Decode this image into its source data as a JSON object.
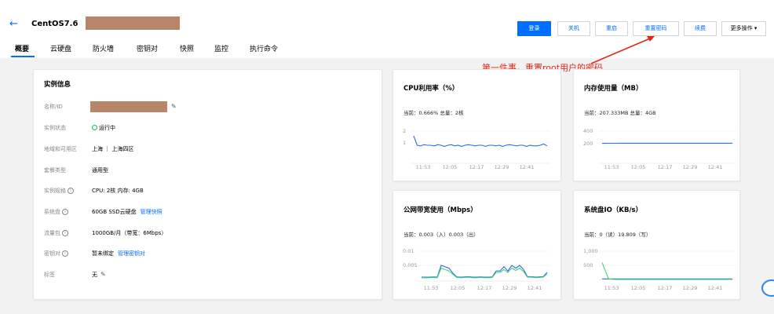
{
  "header": {
    "back_icon": "arrow-left-icon",
    "title": "CentOS7.6"
  },
  "actions": [
    {
      "label": "登录",
      "primary": true
    },
    {
      "label": "关机",
      "primary": false
    },
    {
      "label": "重启",
      "primary": false
    },
    {
      "label": "重置密码",
      "primary": false
    },
    {
      "label": "续费",
      "primary": false
    },
    {
      "label": "更多操作 ▾",
      "primary": false
    }
  ],
  "tabs": [
    {
      "label": "概要",
      "active": true
    },
    {
      "label": "云硬盘"
    },
    {
      "label": "防火墙"
    },
    {
      "label": "密钥对"
    },
    {
      "label": "快照"
    },
    {
      "label": "监控"
    },
    {
      "label": "执行命令"
    }
  ],
  "annotation": "第一件事，重置root用户的密码",
  "instance": {
    "title": "实例信息",
    "rows": [
      {
        "label": "名称/ID",
        "value": ""
      },
      {
        "label": "实例状态",
        "value": "运行中"
      },
      {
        "label": "地域和可用区",
        "value": "上海 ｜ 上海四区"
      },
      {
        "label": "套餐类型",
        "value": "通用型"
      },
      {
        "label": "实例规格",
        "value": "CPU: 2核 内存: 4GB"
      },
      {
        "label": "系统盘",
        "value": "60GB SSD云硬盘",
        "link": "管理快照"
      },
      {
        "label": "流量包",
        "value": "1000GB/月（带宽：6Mbps）"
      },
      {
        "label": "密钥对",
        "value": "暂未绑定",
        "link": "管理密钥对"
      },
      {
        "label": "标签",
        "value": "无"
      }
    ],
    "help_glyph": "i"
  },
  "metrics": [
    {
      "title": "CPU利用率（%）",
      "current": "当前：0.666% 总量：2核",
      "ticks_y": [
        "2",
        "1"
      ],
      "ticks_x": [
        "11:53",
        "12:05",
        "12:17",
        "12:29",
        "12:41"
      ]
    },
    {
      "title": "内存使用量（MB）",
      "current": "当前：207.333MB 总量：4GB",
      "ticks_y": [
        "400",
        "200"
      ],
      "ticks_x": [
        "11:53",
        "12:05",
        "12:17",
        "12:29",
        "12:41"
      ]
    },
    {
      "title": "公网带宽使用（Mbps）",
      "current": "当前：0.003（入）0.003（出）",
      "ticks_y": [
        "0.01",
        "0.005"
      ],
      "ticks_x": [
        "11:53",
        "12:05",
        "12:17",
        "12:29",
        "12:41"
      ]
    },
    {
      "title": "系统盘IO（KB/s）",
      "current": "当前：0（读）19.809（写）",
      "ticks_y": [
        "1,000",
        "500"
      ],
      "ticks_x": [
        "11:53",
        "12:05",
        "12:17",
        "12:29",
        "12:41"
      ]
    }
  ],
  "chart_data": [
    {
      "type": "line",
      "title": "CPU利用率（%）",
      "x": [
        "11:53",
        "12:05",
        "12:17",
        "12:29",
        "12:41"
      ],
      "ylim": [
        0,
        2
      ],
      "series": [
        {
          "values": [
            1.6,
            0.8,
            0.75,
            0.85,
            0.8,
            0.8,
            0.75,
            0.85,
            0.8,
            0.7,
            0.8,
            0.85,
            0.75,
            0.8,
            0.7,
            0.8,
            0.85,
            0.8,
            0.75,
            0.8,
            0.8,
            0.7,
            0.8,
            0.8,
            0.75,
            0.8,
            0.7,
            0.8,
            0.85,
            0.8,
            0.75,
            0.8,
            0.8,
            0.7,
            0.8,
            0.75,
            0.75,
            0.8,
            0.9,
            0.75
          ],
          "color": "#2e6ee0"
        }
      ]
    },
    {
      "type": "line",
      "title": "内存使用量（MB）",
      "x": [
        "11:53",
        "12:05",
        "12:17",
        "12:29",
        "12:41"
      ],
      "ylim": [
        0,
        400
      ],
      "series": [
        {
          "values": [
            205,
            206,
            206,
            207,
            207,
            207,
            207,
            207,
            207,
            207,
            207,
            207,
            207,
            207,
            207,
            207,
            207,
            207,
            207,
            207
          ],
          "color": "#2e6ee0"
        }
      ]
    },
    {
      "type": "line",
      "title": "公网带宽使用（Mbps）",
      "x": [
        "11:53",
        "12:05",
        "12:17",
        "12:29",
        "12:41"
      ],
      "ylim": [
        0,
        0.01
      ],
      "series": [
        {
          "values": [
            0.0008,
            0.0008,
            0.0008,
            0.0009,
            0.0008,
            0.005,
            0.0045,
            0.004,
            0.0022,
            0.0009,
            0.0008,
            0.0009,
            0.001,
            0.0008,
            0.0008,
            0.0009,
            0.0008,
            0.0008,
            0.0009,
            0.003,
            0.003,
            0.0045,
            0.003,
            0.005,
            0.004,
            0.005,
            0.0035,
            0.001,
            0.001,
            0.0008,
            0.0009,
            0.001,
            0.0025
          ],
          "color": "#2e6ee0"
        },
        {
          "values": [
            0.0006,
            0.0006,
            0.0006,
            0.0007,
            0.0006,
            0.004,
            0.0035,
            0.003,
            0.0018,
            0.0007,
            0.0006,
            0.0007,
            0.0008,
            0.0006,
            0.0006,
            0.0007,
            0.0006,
            0.0006,
            0.0007,
            0.0025,
            0.0025,
            0.0035,
            0.0025,
            0.004,
            0.0032,
            0.004,
            0.0028,
            0.0008,
            0.0008,
            0.0006,
            0.0007,
            0.0008,
            0.002
          ],
          "color": "#3fd27a"
        }
      ]
    },
    {
      "type": "line",
      "title": "系统盘IO（KB/s）",
      "x": [
        "11:53",
        "12:05",
        "12:17",
        "12:29",
        "12:41"
      ],
      "ylim": [
        0,
        1000
      ],
      "series": [
        {
          "values": [
            20,
            20,
            20,
            20,
            20,
            20,
            20,
            20,
            20,
            20,
            20,
            20,
            20,
            20,
            20,
            20,
            20,
            20,
            20,
            20,
            20
          ],
          "color": "#2e6ee0"
        },
        {
          "values": [
            600,
            20,
            0,
            0,
            0,
            0,
            0,
            0,
            0,
            0,
            0,
            0,
            0,
            0,
            0,
            0,
            0,
            0,
            0,
            0,
            0
          ],
          "color": "#3fd27a"
        }
      ]
    }
  ],
  "colors": {
    "accent": "#006eff",
    "annotation": "#e0271a",
    "masked": "#b9856a",
    "running": "#0abf5b"
  }
}
